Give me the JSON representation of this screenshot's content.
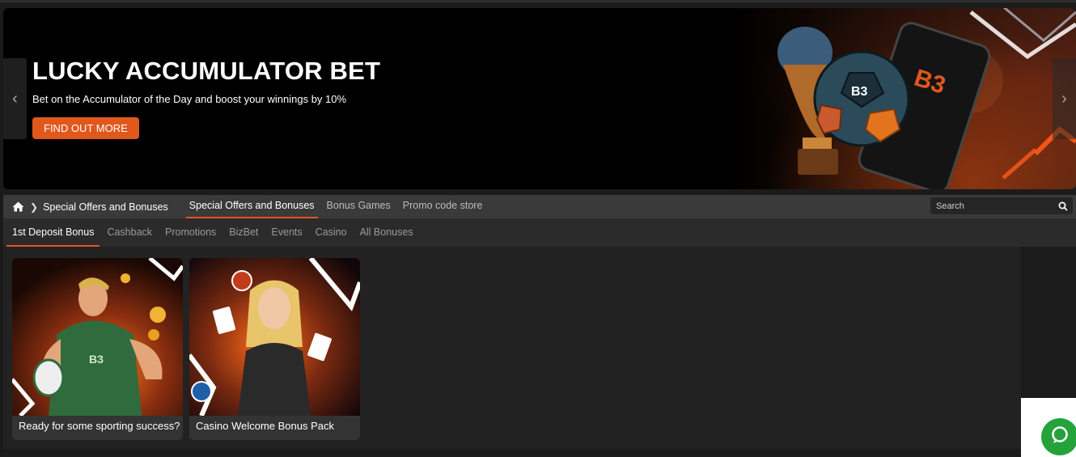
{
  "banner": {
    "title": "LUCKY ACCUMULATOR BET",
    "subtitle": "Bet on the Accumulator of the Day and boost your winnings by 10%",
    "cta_label": "FIND OUT MORE",
    "prev_icon": "chevron-left-icon",
    "next_icon": "chevron-right-icon"
  },
  "breadcrumb": {
    "home_icon": "home-icon",
    "current": "Special Offers and Bonuses"
  },
  "nav": {
    "tabs": [
      {
        "label": "Special Offers and Bonuses",
        "active": true
      },
      {
        "label": "Bonus Games",
        "active": false
      },
      {
        "label": "Promo code store",
        "active": false
      }
    ],
    "search_placeholder": "Search"
  },
  "subnav": {
    "tabs": [
      {
        "label": "1st Deposit Bonus",
        "active": true
      },
      {
        "label": "Cashback",
        "active": false
      },
      {
        "label": "Promotions",
        "active": false
      },
      {
        "label": "BizBet",
        "active": false
      },
      {
        "label": "Events",
        "active": false
      },
      {
        "label": "Casino",
        "active": false
      },
      {
        "label": "All Bonuses",
        "active": false
      }
    ]
  },
  "cards": [
    {
      "caption": "Ready for some sporting success?",
      "image": "rugby-player-illustration"
    },
    {
      "caption": "Casino Welcome Bonus Pack",
      "image": "casino-woman-cards-illustration"
    }
  ],
  "colors": {
    "accent": "#e0581c",
    "chat": "#23a33a"
  }
}
